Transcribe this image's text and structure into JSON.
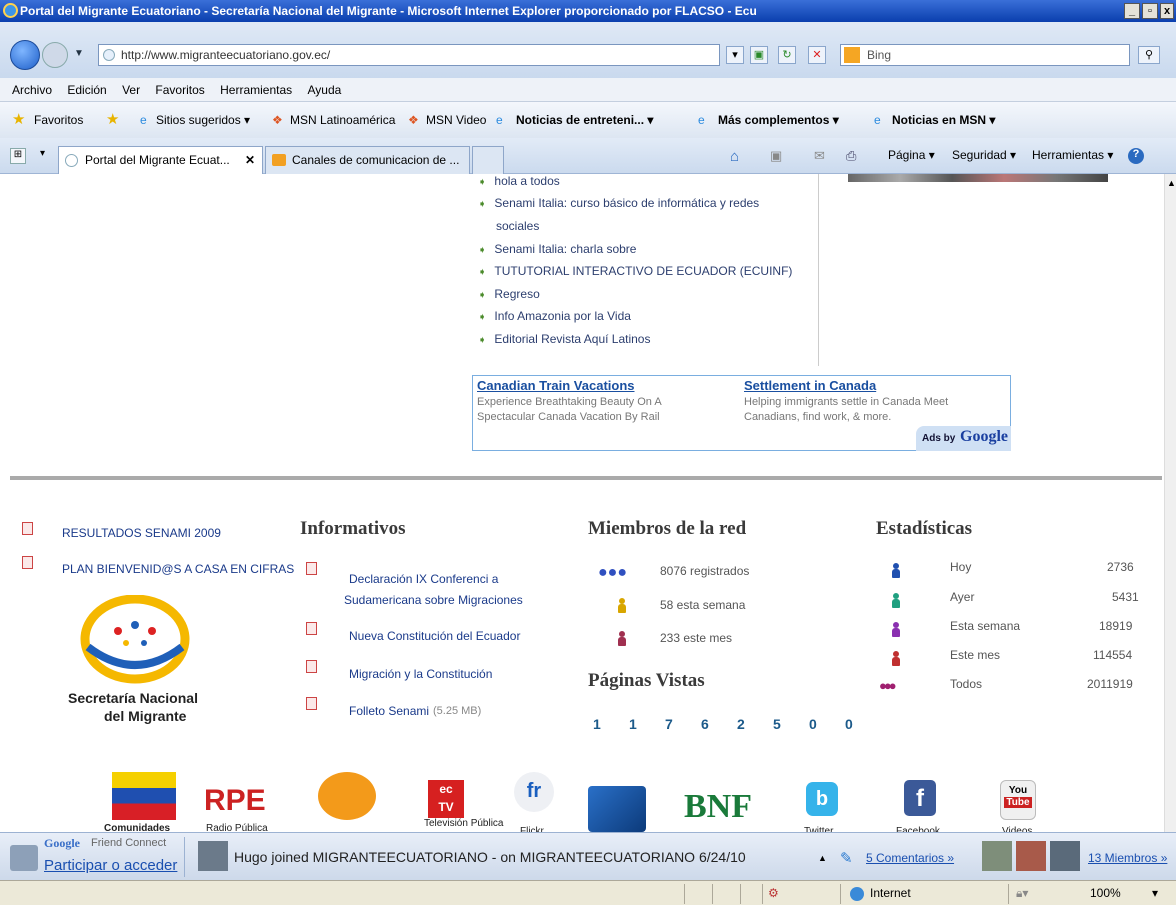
{
  "window": {
    "title": "Portal del Migrante Ecuatoriano - Secretaría Nacional del Migrante - Microsoft Internet Explorer proporcionado por FLACSO - Ecu"
  },
  "address": {
    "url": "http://www.migranteecuatoriano.gov.ec/",
    "search_placeholder": "Bing"
  },
  "menu": [
    "Archivo",
    "Edición",
    "Ver",
    "Favoritos",
    "Herramientas",
    "Ayuda"
  ],
  "favorites": {
    "label": "Favoritos",
    "items": [
      "Sitios sugeridos ▾",
      "MSN Latinoamérica",
      "MSN Video",
      "Noticias de entreteni... ▾",
      "Más complementos ▾",
      "Noticias en MSN ▾"
    ]
  },
  "tabs": [
    {
      "label": "Portal del Migrante Ecuat..."
    },
    {
      "label": "Canales de comunicacion de ..."
    }
  ],
  "commandbar": {
    "pagina": "Página ▾",
    "seguridad": "Seguridad ▾",
    "herramientas": "Herramientas ▾"
  },
  "news_list": [
    "hola a todos",
    "Senami Italia: curso básico de informática y redes",
    "sociales",
    "Senami Italia: charla sobre",
    "TUTUTORIAL INTERACTIVO DE ECUADOR (ECUINF)",
    "Regreso",
    "Info Amazonia por la Vida",
    "Editorial Revista Aquí Latinos"
  ],
  "ads": {
    "items": [
      {
        "title": "Canadian Train Vacations",
        "text1": "Experience Breathtaking Beauty On A",
        "text2": "Spectacular Canada Vacation By Rail"
      },
      {
        "title": "Settlement in Canada",
        "text1": "Helping immigrants settle in Canada Meet",
        "text2": "Canadians, find work, & more."
      }
    ],
    "ads_by": "Ads by",
    "google": "Google"
  },
  "left_links": [
    "RESULTADOS SENAMI 2009",
    "PLAN BIENVENID@S A CASA EN CIFRAS"
  ],
  "logo": {
    "line1": "Secretaría Nacional",
    "line2": "del Migrante"
  },
  "informativos": {
    "title": "Informativos",
    "items": [
      "Declaración IX Conferenci a",
      "Sudamericana sobre Migraciones",
      "Nueva Constitución del Ecuador",
      "Migración y la Constitución",
      "Folleto Senami"
    ],
    "size_note": "(5.25 MB)"
  },
  "miembros": {
    "title": "Miembros de la red",
    "registrados": "8076 registrados",
    "semana": "58 esta semana",
    "mes": "233 este mes"
  },
  "paginas": {
    "title": "Páginas Vistas",
    "digits": [
      "1",
      "1",
      "7",
      "6",
      "2",
      "5",
      "0",
      "0"
    ]
  },
  "estadisticas": {
    "title": "Estadísticas",
    "rows": [
      {
        "label": "Hoy",
        "value": "2736"
      },
      {
        "label": "Ayer",
        "value": "5431"
      },
      {
        "label": "Esta semana",
        "value": "18919"
      },
      {
        "label": "Este mes",
        "value": "114554"
      },
      {
        "label": "Todos",
        "value": "2011919"
      }
    ]
  },
  "social": {
    "comunidades": "Comunidades",
    "radio": "Radio Pública",
    "tv": "Televisión Pública",
    "flickr": "Flickr",
    "twitter": "Twitter",
    "facebook": "Facebook",
    "videos": "Videos",
    "rpe": "RPE",
    "bnf": "BNF",
    "fr": "fr",
    "ec": "ec",
    "tv_short": "TV",
    "you": "You",
    "tube": "Tube",
    "b": "b",
    "f": "f"
  },
  "gfc": {
    "brand": "Google",
    "brand2": "Friend Connect",
    "action": "Participar o acceder",
    "activity": "Hugo joined MIGRANTEECUATORIANO -  on MIGRANTEECUATORIANO 6/24/10",
    "comments": "5 Comentarios »",
    "members": "13 Miembros »"
  },
  "status": {
    "zone": "Internet",
    "zoom": "100%"
  }
}
